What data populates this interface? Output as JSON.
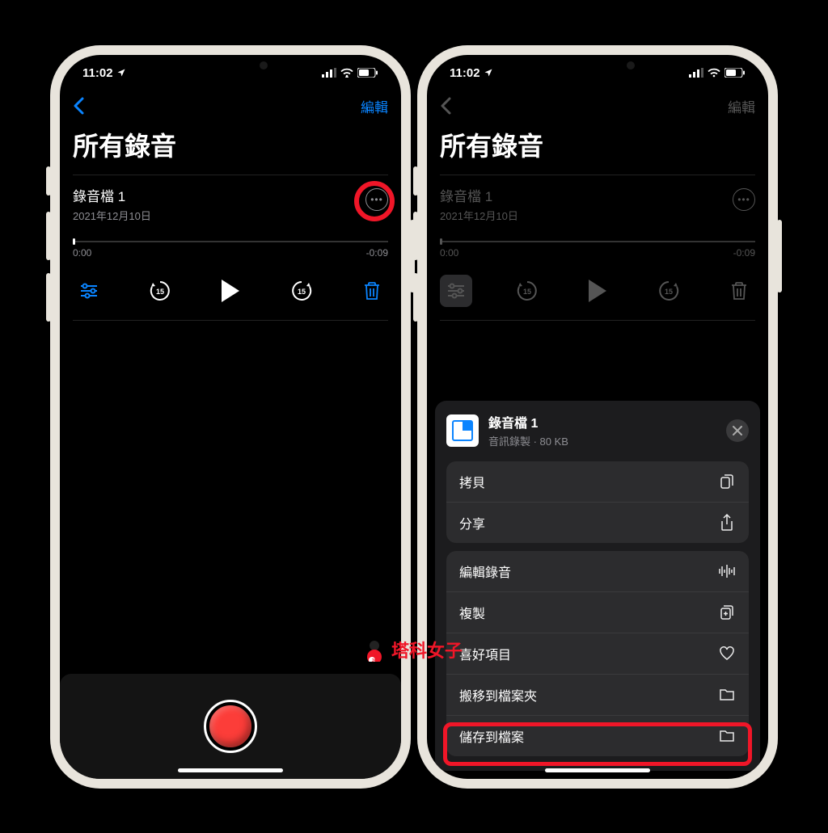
{
  "status": {
    "time": "11:02",
    "location_icon": "location-arrow"
  },
  "nav": {
    "edit": "編輯"
  },
  "title": "所有錄音",
  "recording": {
    "name": "錄音檔 1",
    "date": "2021年12月10日",
    "elapsed": "0:00",
    "remaining": "-0:09",
    "skip_back": "15",
    "skip_fwd": "15"
  },
  "sheet": {
    "file_name": "錄音檔 1",
    "file_meta": "音訊錄製 · 80 KB",
    "groups": [
      [
        {
          "label": "拷貝",
          "icon": "copy-doc"
        },
        {
          "label": "分享",
          "icon": "share"
        }
      ],
      [
        {
          "label": "編輯錄音",
          "icon": "waveform"
        },
        {
          "label": "複製",
          "icon": "duplicate"
        },
        {
          "label": "喜好項目",
          "icon": "heart"
        },
        {
          "label": "搬移到檔案夾",
          "icon": "folder"
        },
        {
          "label": "儲存到檔案",
          "icon": "folder"
        }
      ]
    ]
  },
  "watermark": "塔科女子"
}
